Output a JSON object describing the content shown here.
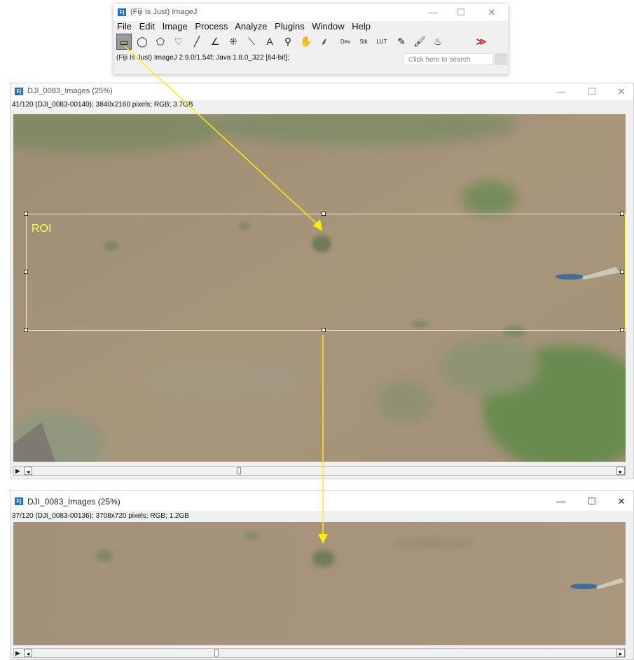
{
  "fiji_window": {
    "title": "(Fiji Is Just) ImageJ",
    "menu": [
      "File",
      "Edit",
      "Image",
      "Process",
      "Analyze",
      "Plugins",
      "Window",
      "Help"
    ],
    "tools": [
      {
        "name": "rectangle-tool",
        "glyph": "▭",
        "selected": true
      },
      {
        "name": "oval-tool",
        "glyph": "◯"
      },
      {
        "name": "polygon-tool",
        "glyph": "⬠"
      },
      {
        "name": "freehand-tool",
        "glyph": "♡"
      },
      {
        "name": "line-tool",
        "glyph": "╱"
      },
      {
        "name": "angle-tool",
        "glyph": "∠"
      },
      {
        "name": "point-tool",
        "glyph": "⁜"
      },
      {
        "name": "wand-tool",
        "glyph": "⟍"
      },
      {
        "name": "text-tool",
        "glyph": "A"
      },
      {
        "name": "magnifier-tool",
        "glyph": "⚲"
      },
      {
        "name": "hand-tool",
        "glyph": "✋"
      },
      {
        "name": "dropper-tool",
        "glyph": "⸙"
      },
      {
        "name": "dev-tool",
        "glyph": "Dev"
      },
      {
        "name": "stk-tool",
        "glyph": "Stk"
      },
      {
        "name": "lut-tool",
        "glyph": "LUT"
      },
      {
        "name": "pencil-tool",
        "glyph": "✎"
      },
      {
        "name": "brush-tool",
        "glyph": "🖌"
      },
      {
        "name": "flood-fill-tool",
        "glyph": "♨"
      },
      {
        "name": "more-tools",
        "glyph": "≫"
      }
    ],
    "status": "(Fiji Is Just) ImageJ 2.9.0/1.54f; Java 1.8.0_322 [64-bit];",
    "search_placeholder": "Click here to search"
  },
  "image_window_1": {
    "title": "DJI_0083_Images (25%)",
    "info": "41/120 (DJI_0083-00140); 3840x2160 pixels; RGB; 3.7GB",
    "roi_label": "ROI"
  },
  "image_window_2": {
    "title": "DJI_0083_Images (25%)",
    "info": "37/120 (DJI_0083-00136); 3708x720 pixels; RGB; 1.2GB"
  },
  "window_controls": {
    "minimize": "—",
    "maximize": "☐",
    "close": "✕"
  },
  "colors": {
    "roi": "#ffff33",
    "arrow": "#ffee00",
    "water": "#a6957a",
    "vegetation": "#6b8a52"
  }
}
